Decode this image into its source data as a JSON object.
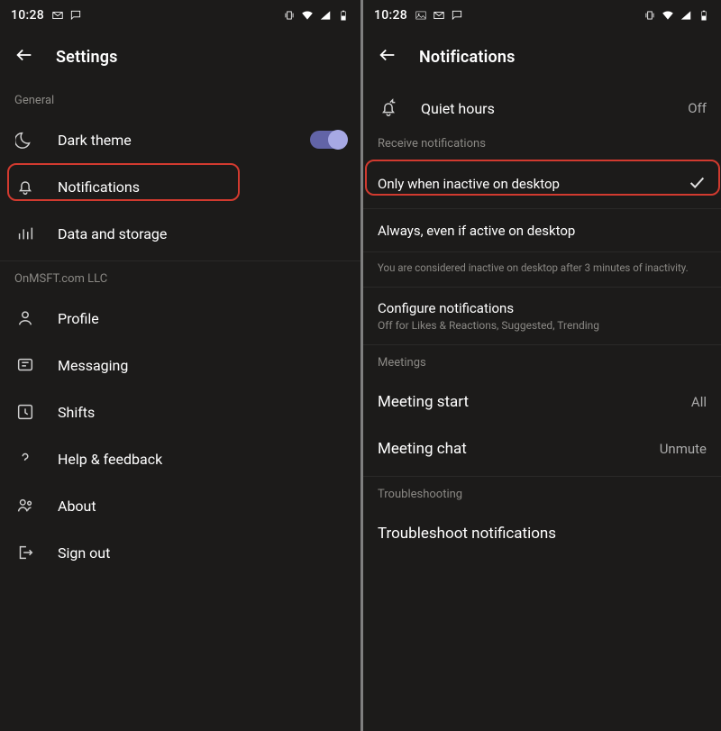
{
  "statusBar": {
    "time": "10:28"
  },
  "left": {
    "title": "Settings",
    "sectionGeneral": "General",
    "darkTheme": "Dark theme",
    "notifications": "Notifications",
    "dataStorage": "Data and storage",
    "sectionOrg": "OnMSFT.com LLC",
    "profile": "Profile",
    "messaging": "Messaging",
    "shifts": "Shifts",
    "help": "Help & feedback",
    "about": "About",
    "signOut": "Sign out"
  },
  "right": {
    "title": "Notifications",
    "quietHours": {
      "label": "Quiet hours",
      "value": "Off"
    },
    "receiveHeader": "Receive notifications",
    "opt1": "Only when inactive on desktop",
    "opt2": "Always, even if active on desktop",
    "inactivityNote": "You are considered inactive on desktop after 3 minutes of inactivity.",
    "config": {
      "label": "Configure notifications",
      "sub": "Off for Likes & Reactions, Suggested, Trending"
    },
    "meetingsHeader": "Meetings",
    "meetingStart": {
      "label": "Meeting start",
      "value": "All"
    },
    "meetingChat": {
      "label": "Meeting chat",
      "value": "Unmute"
    },
    "troubleshootHeader": "Troubleshooting",
    "troubleshoot": "Troubleshoot notifications"
  }
}
